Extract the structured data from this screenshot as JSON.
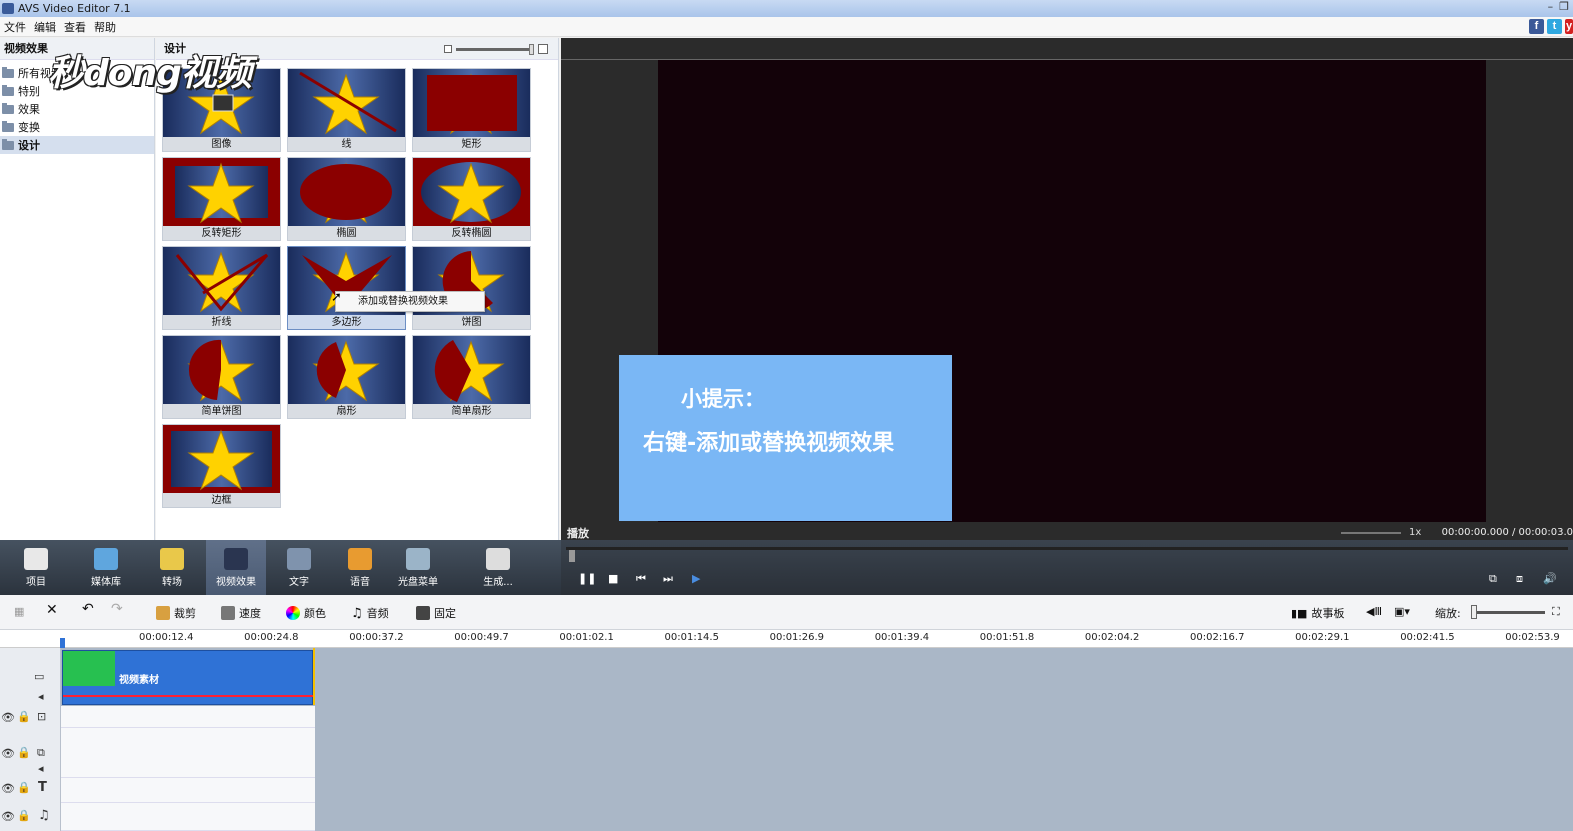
{
  "window": {
    "title": "AVS Video Editor 7.1"
  },
  "menu": [
    "文件",
    "编辑",
    "查看",
    "帮助"
  ],
  "social": [
    "f",
    "t",
    "y"
  ],
  "left_panel": {
    "header": "视频效果",
    "items": [
      "所有视频",
      "特别",
      "效果",
      "变换",
      "设计"
    ]
  },
  "gallery": {
    "header": "设计",
    "items": [
      "图像",
      "线",
      "矩形",
      "反转矩形",
      "椭圆",
      "反转椭圆",
      "折线",
      "多边形",
      "饼图",
      "简单饼图",
      "扇形",
      "简单扇形",
      "边框"
    ],
    "context_menu": "添加或替换视频效果"
  },
  "logo": "秒dong视频",
  "preview": {
    "label": "播放",
    "speed": "1x",
    "timecode": "00:00:00.000 / 00:00:03.0",
    "tip_title": "小提示：",
    "tip_body": "右键-添加或替换视频效果"
  },
  "nav": [
    "项目",
    "媒体库",
    "转场",
    "视频效果",
    "文字",
    "语音",
    "光盘菜单",
    "生成..."
  ],
  "player_controls": {
    "pause": "❚❚",
    "stop": "■",
    "prev": "⏮",
    "next": "⏭",
    "frame": "▶"
  },
  "timeline_toolbar": {
    "crop": "裁剪",
    "speed": "速度",
    "color": "颜色",
    "audio": "音频",
    "freeze": "固定",
    "storyboard": "故事板",
    "zoom": "缩放:"
  },
  "ruler": [
    "00:00:12.4",
    "00:00:24.8",
    "00:00:37.2",
    "00:00:49.7",
    "00:01:02.1",
    "00:01:14.5",
    "00:01:26.9",
    "00:01:39.4",
    "00:01:51.8",
    "00:02:04.2",
    "00:02:16.7",
    "00:02:29.1",
    "00:02:41.5",
    "00:02:53.9"
  ],
  "clip": {
    "label": "视频素材"
  },
  "colors": {
    "accent": "#2f72d6",
    "clip_green": "#27c050",
    "tip_bg": "#7ab7f5",
    "effect_red": "#8b0000",
    "star": "#ffd200"
  }
}
